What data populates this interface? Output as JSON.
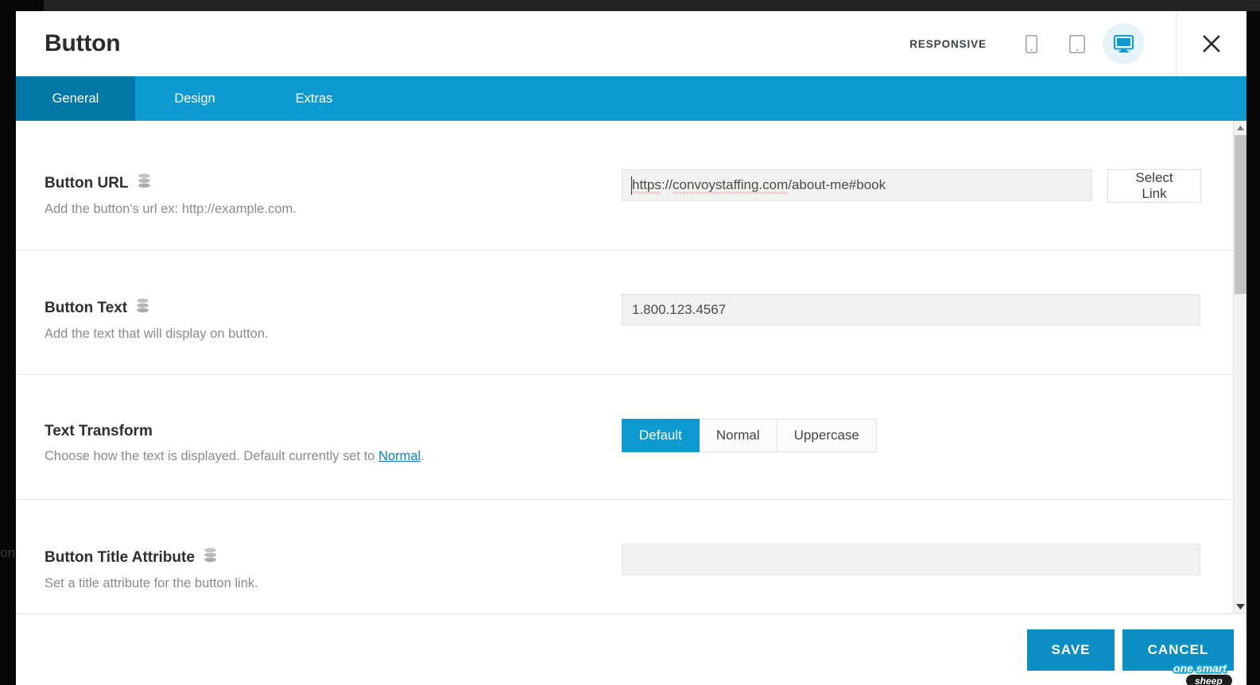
{
  "backdrop": {
    "ghost_text": "on"
  },
  "header": {
    "title": "Button",
    "responsive_label": "RESPONSIVE",
    "devices": [
      {
        "name": "mobile-icon",
        "label": "Mobile",
        "active": false
      },
      {
        "name": "tablet-icon",
        "label": "Tablet",
        "active": false
      },
      {
        "name": "desktop-icon",
        "label": "Desktop",
        "active": true
      }
    ],
    "close_label": "Close"
  },
  "tabs": [
    {
      "label": "General",
      "active": true
    },
    {
      "label": "Design",
      "active": false
    },
    {
      "label": "Extras",
      "active": false
    }
  ],
  "fields": {
    "button_url": {
      "label": "Button URL",
      "description": "Add the button's url ex: http://example.com.",
      "value": "https://convoystaffing.com/about-me#book",
      "value_parts": {
        "scheme": "https",
        "sep": "://",
        "host": "convoystaffing.com",
        "path": "/about-me#book"
      },
      "select_link_label": "Select Link",
      "icon": "database-icon"
    },
    "button_text": {
      "label": "Button Text",
      "description": "Add the text that will display on button.",
      "value": "1.800.123.4567",
      "icon": "database-icon"
    },
    "text_transform": {
      "label": "Text Transform",
      "description_before": "Choose how the text is displayed. Default currently set to ",
      "description_link": "Normal",
      "description_after": ".",
      "options": [
        {
          "label": "Default",
          "active": true
        },
        {
          "label": "Normal",
          "active": false
        },
        {
          "label": "Uppercase",
          "active": false
        }
      ]
    },
    "button_title_attribute": {
      "label": "Button Title Attribute",
      "description": "Set a title attribute for the button link.",
      "value": "",
      "placeholder": "",
      "icon": "database-icon"
    }
  },
  "footer": {
    "save_label": "SAVE",
    "cancel_label": "CANCEL"
  },
  "watermark": {
    "line1": "one smart",
    "line2": "sheep"
  },
  "colors": {
    "accent": "#0c9ad0",
    "accent_dark": "#0178a8",
    "footer_button": "#0c8ec2",
    "link": "#0a7fb0"
  }
}
